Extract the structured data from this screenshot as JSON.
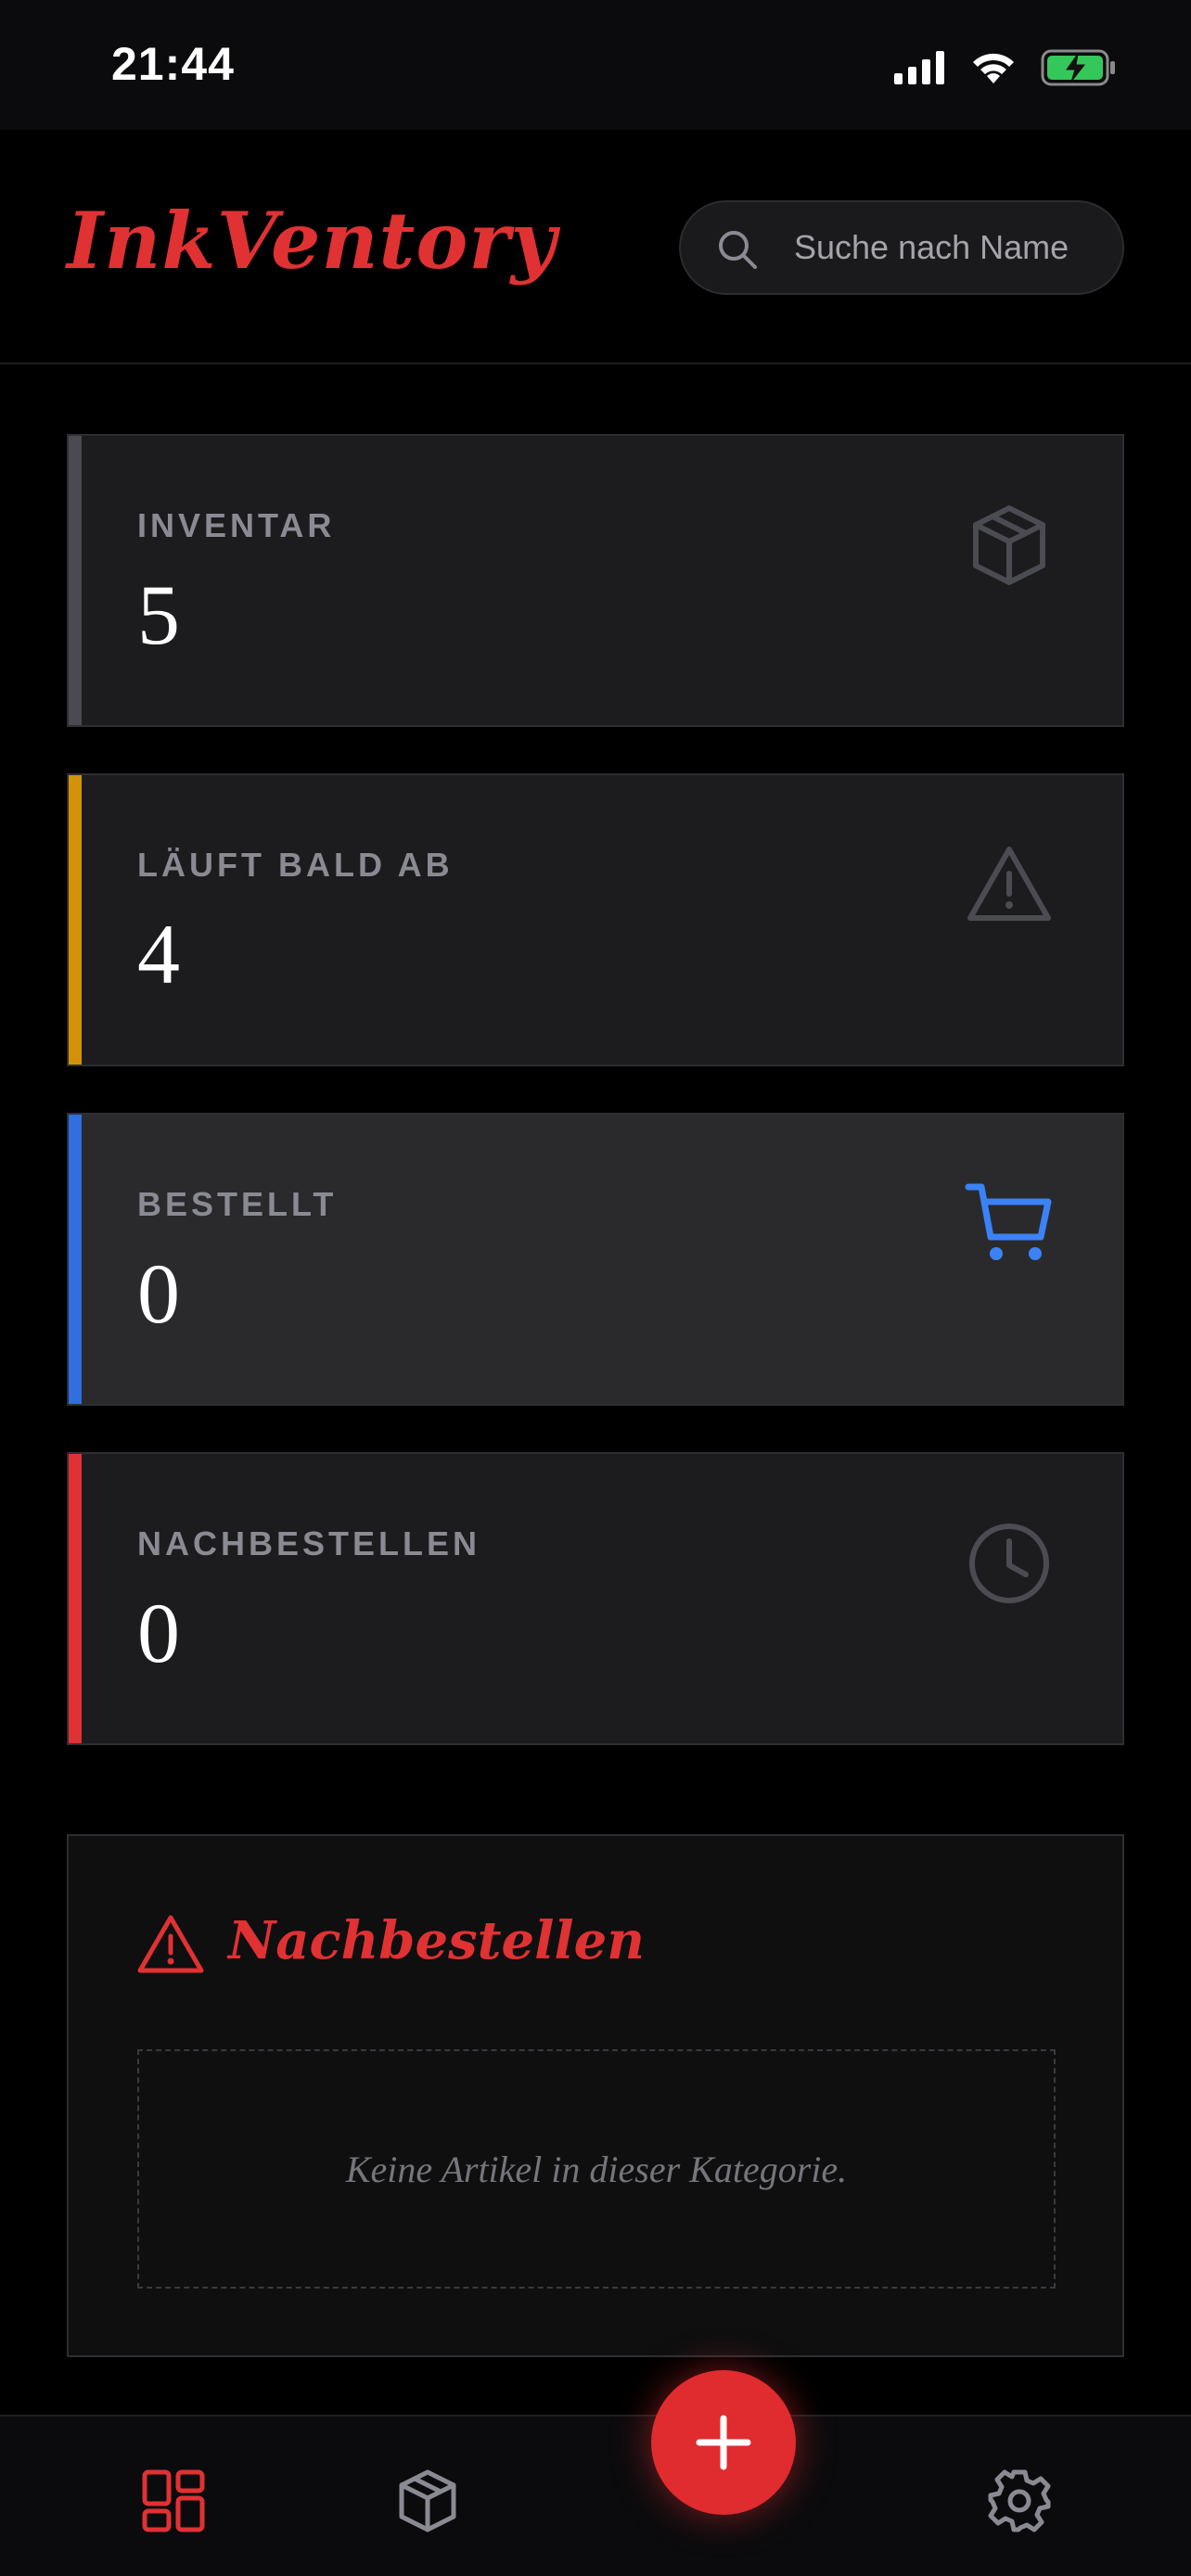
{
  "status_bar": {
    "time": "21:44",
    "icons": [
      "signal-icon",
      "wifi-icon",
      "battery-charging-icon"
    ]
  },
  "header": {
    "title": "InkVentory",
    "search": {
      "placeholder": "Suche nach Name",
      "value": ""
    }
  },
  "stats": [
    {
      "label": "INVENTAR",
      "value": "5",
      "icon": "box-icon",
      "accent": "#4a4a50"
    },
    {
      "label": "LÄUFT BALD AB",
      "value": "4",
      "icon": "warning-icon",
      "accent": "#d4920a"
    },
    {
      "label": "BESTELLT",
      "value": "0",
      "icon": "cart-icon",
      "accent": "#2f6fe0"
    },
    {
      "label": "NACHBESTELLEN",
      "value": "0",
      "icon": "clock-icon",
      "accent": "#e03133"
    }
  ],
  "reorder_panel": {
    "title": "Nachbestellen",
    "empty_text": "Keine Artikel in dieser Kategorie."
  },
  "bottom_nav": {
    "items": [
      "dashboard-icon",
      "inventory-box-icon",
      "settings-icon"
    ],
    "fab": "plus-icon"
  },
  "colors": {
    "brand": "#e03133",
    "highlight_blue": "#3b82f6"
  }
}
